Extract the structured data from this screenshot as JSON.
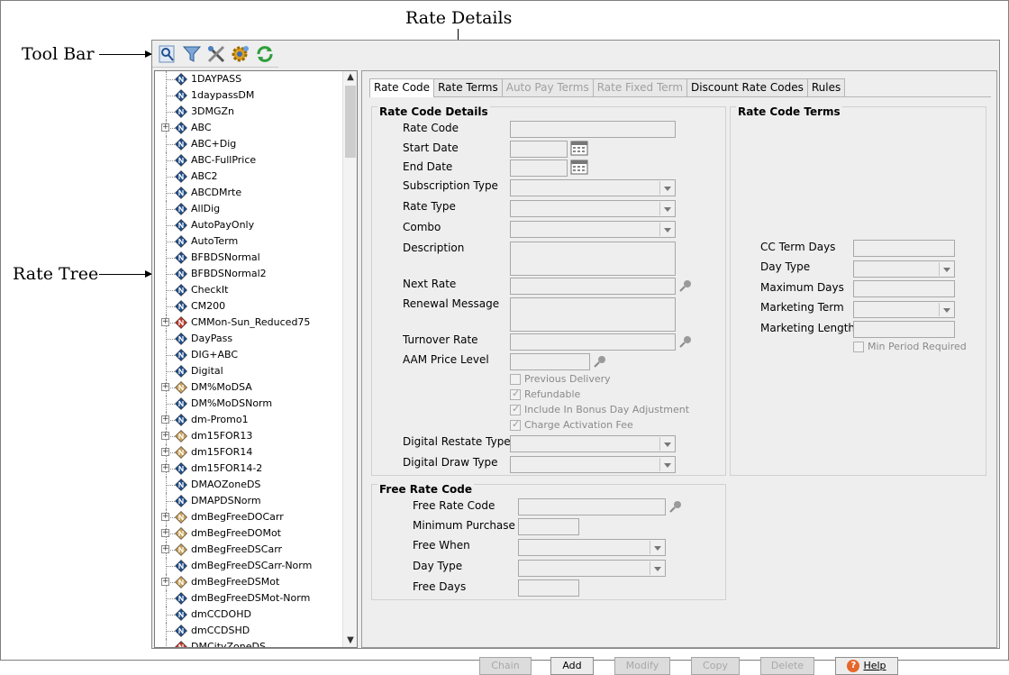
{
  "callouts": {
    "tool_bar": "Tool Bar",
    "rate_tree": "Rate Tree",
    "rate_details": "Rate Details"
  },
  "toolbar": {
    "icons": [
      "search-key-icon",
      "filter-funnel-icon",
      "tools-icon",
      "settings-gear-icon",
      "refresh-icon"
    ]
  },
  "tree": {
    "items": [
      {
        "label": "1DAYPASS",
        "expandable": false,
        "icon": "blue"
      },
      {
        "label": "1daypassDM",
        "expandable": false,
        "icon": "blue"
      },
      {
        "label": "3DMGZn",
        "expandable": false,
        "icon": "blue"
      },
      {
        "label": "ABC",
        "expandable": true,
        "icon": "blue"
      },
      {
        "label": "ABC+Dig",
        "expandable": false,
        "icon": "blue"
      },
      {
        "label": "ABC-FullPrice",
        "expandable": false,
        "icon": "blue"
      },
      {
        "label": "ABC2",
        "expandable": false,
        "icon": "blue"
      },
      {
        "label": "ABCDMrte",
        "expandable": false,
        "icon": "blue"
      },
      {
        "label": "AllDig",
        "expandable": false,
        "icon": "blue"
      },
      {
        "label": "AutoPayOnly",
        "expandable": false,
        "icon": "blue"
      },
      {
        "label": "AutoTerm",
        "expandable": false,
        "icon": "blue"
      },
      {
        "label": "BFBDSNormal",
        "expandable": false,
        "icon": "blue"
      },
      {
        "label": "BFBDSNormal2",
        "expandable": false,
        "icon": "blue"
      },
      {
        "label": "CheckIt",
        "expandable": false,
        "icon": "blue"
      },
      {
        "label": "CM200",
        "expandable": false,
        "icon": "blue"
      },
      {
        "label": "CMMon-Sun_Reduced75",
        "expandable": true,
        "icon": "red"
      },
      {
        "label": "DayPass",
        "expandable": false,
        "icon": "blue"
      },
      {
        "label": "DIG+ABC",
        "expandable": false,
        "icon": "blue"
      },
      {
        "label": "Digital",
        "expandable": false,
        "icon": "blue"
      },
      {
        "label": "DM%MoDSA",
        "expandable": true,
        "icon": "tan"
      },
      {
        "label": "DM%MoDSNorm",
        "expandable": false,
        "icon": "blue"
      },
      {
        "label": "dm-Promo1",
        "expandable": true,
        "icon": "blue"
      },
      {
        "label": "dm15FOR13",
        "expandable": true,
        "icon": "tan"
      },
      {
        "label": "dm15FOR14",
        "expandable": true,
        "icon": "tan"
      },
      {
        "label": "dm15FOR14-2",
        "expandable": true,
        "icon": "blue"
      },
      {
        "label": "DMAOZoneDS",
        "expandable": false,
        "icon": "blue"
      },
      {
        "label": "DMAPDSNorm",
        "expandable": false,
        "icon": "blue"
      },
      {
        "label": "dmBegFreeDOCarr",
        "expandable": true,
        "icon": "tan"
      },
      {
        "label": "dmBegFreeDOMot",
        "expandable": true,
        "icon": "tan"
      },
      {
        "label": "dmBegFreeDSCarr",
        "expandable": true,
        "icon": "tan"
      },
      {
        "label": "dmBegFreeDSCarr-Norm",
        "expandable": false,
        "icon": "blue"
      },
      {
        "label": "dmBegFreeDSMot",
        "expandable": true,
        "icon": "tan"
      },
      {
        "label": "dmBegFreeDSMot-Norm",
        "expandable": false,
        "icon": "blue"
      },
      {
        "label": "dmCCDOHD",
        "expandable": false,
        "icon": "blue"
      },
      {
        "label": "dmCCDSHD",
        "expandable": false,
        "icon": "blue"
      },
      {
        "label": "DMCityZoneDS",
        "expandable": false,
        "icon": "red"
      }
    ]
  },
  "tabs": [
    {
      "label": "Rate Code",
      "state": "active"
    },
    {
      "label": "Rate Terms",
      "state": "normal"
    },
    {
      "label": "Auto Pay Terms",
      "state": "disabled"
    },
    {
      "label": "Rate Fixed Term",
      "state": "disabled"
    },
    {
      "label": "Discount Rate Codes",
      "state": "normal"
    },
    {
      "label": "Rules",
      "state": "normal"
    }
  ],
  "rate_code_details": {
    "title": "Rate Code Details",
    "rate_code": "Rate Code",
    "start_date": "Start Date",
    "end_date": "End Date",
    "subscription_type": "Subscription Type",
    "rate_type": "Rate Type",
    "combo": "Combo",
    "description": "Description",
    "next_rate": "Next Rate",
    "renewal_message": "Renewal Message",
    "turnover_rate": "Turnover Rate",
    "aam_price_level": "AAM Price Level",
    "previous_delivery": "Previous Delivery",
    "refundable": "Refundable",
    "include_bonus": "Include In Bonus Day Adjustment",
    "charge_activation": "Charge Activation Fee",
    "digital_restate_type": "Digital Restate Type",
    "digital_draw_type": "Digital Draw Type"
  },
  "rate_code_terms": {
    "title": "Rate Code Terms",
    "cc_term_days": "CC Term Days",
    "day_type": "Day Type",
    "maximum_days": "Maximum Days",
    "marketing_term": "Marketing Term",
    "marketing_length": "Marketing Length",
    "min_period_required": "Min Period Required"
  },
  "free_rate_code": {
    "title": "Free Rate Code",
    "free_rate_code": "Free Rate Code",
    "minimum_purchase": "Minimum Purchase",
    "free_when": "Free When",
    "day_type": "Day Type",
    "free_days": "Free Days"
  },
  "buttons": {
    "chain": "Chain",
    "add": "Add",
    "modify": "Modify",
    "copy": "Copy",
    "delete": "Delete",
    "help": "Help"
  },
  "colors": {
    "node_blue": "#1f4f8f",
    "node_red": "#c0392b",
    "node_tan": "#c9a055",
    "help_orange": "#e5672a"
  }
}
